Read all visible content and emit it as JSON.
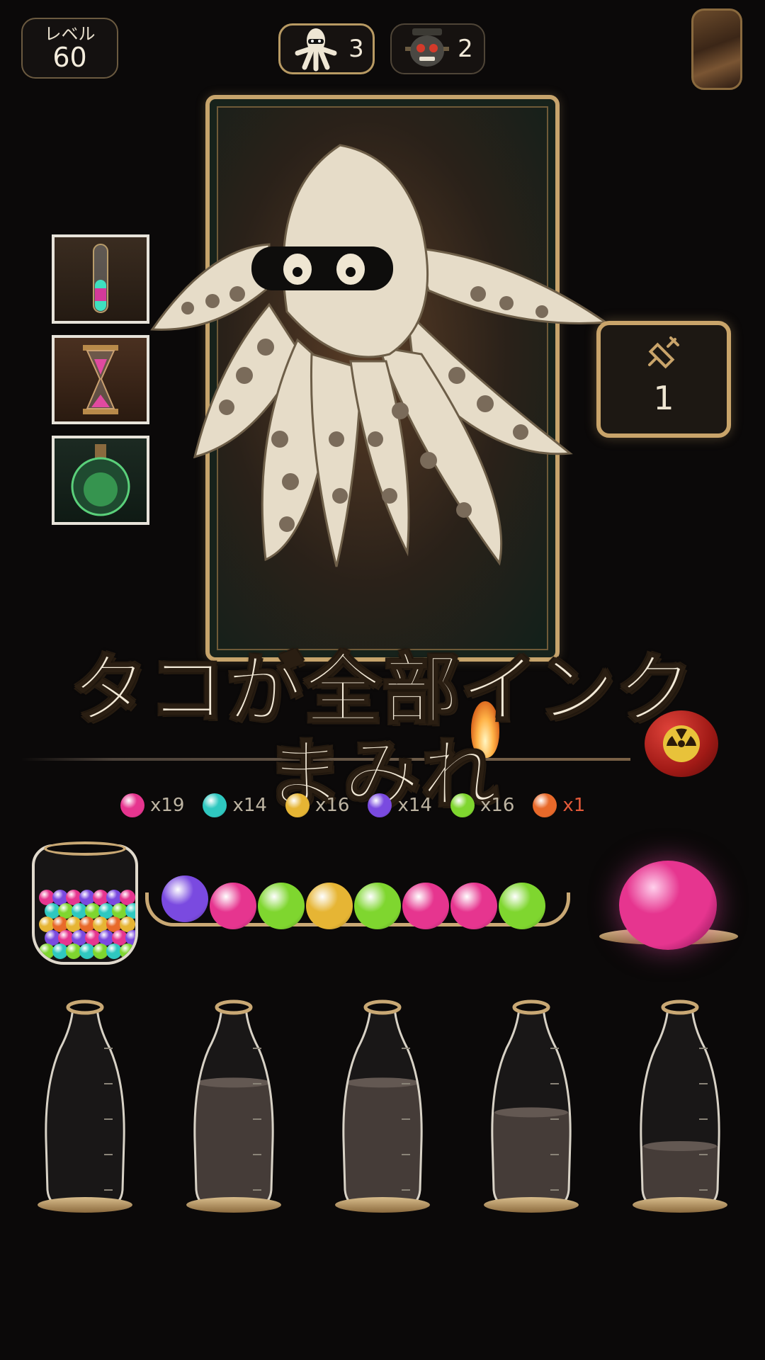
{
  "header": {
    "level_label": "レベル",
    "level_value": "60",
    "octopus_count": "3",
    "monster_count": "2",
    "portrait_icon": "character-portrait"
  },
  "tiles": [
    {
      "icon": "test-tube-icon"
    },
    {
      "icon": "hourglass-icon"
    },
    {
      "icon": "green-flask-icon"
    }
  ],
  "syringe": {
    "icon": "syringe-icon",
    "count": "1"
  },
  "caption": {
    "line1": "タコが全部インク",
    "line2": "まみれ"
  },
  "ball_counts": [
    {
      "color": "#e6358f",
      "label": "x19"
    },
    {
      "color": "#2fc8c0",
      "label": "x14"
    },
    {
      "color": "#e6b534",
      "label": "x16"
    },
    {
      "color": "#7a4ae0",
      "label": "x14"
    },
    {
      "color": "#7fd62f",
      "label": "x16"
    },
    {
      "color": "#e8692a",
      "label": "x1",
      "highlight": "#e45a3a"
    }
  ],
  "queue": [
    "#7a4ae0",
    "#e6358f",
    "#7fd62f",
    "#e6b534",
    "#7fd62f",
    "#e6358f",
    "#e6358f",
    "#7fd62f"
  ],
  "current_ball": "#e6358f",
  "bottles": [
    {
      "fill": 0.0
    },
    {
      "fill": 0.62
    },
    {
      "fill": 0.62
    },
    {
      "fill": 0.47
    },
    {
      "fill": 0.3
    }
  ]
}
